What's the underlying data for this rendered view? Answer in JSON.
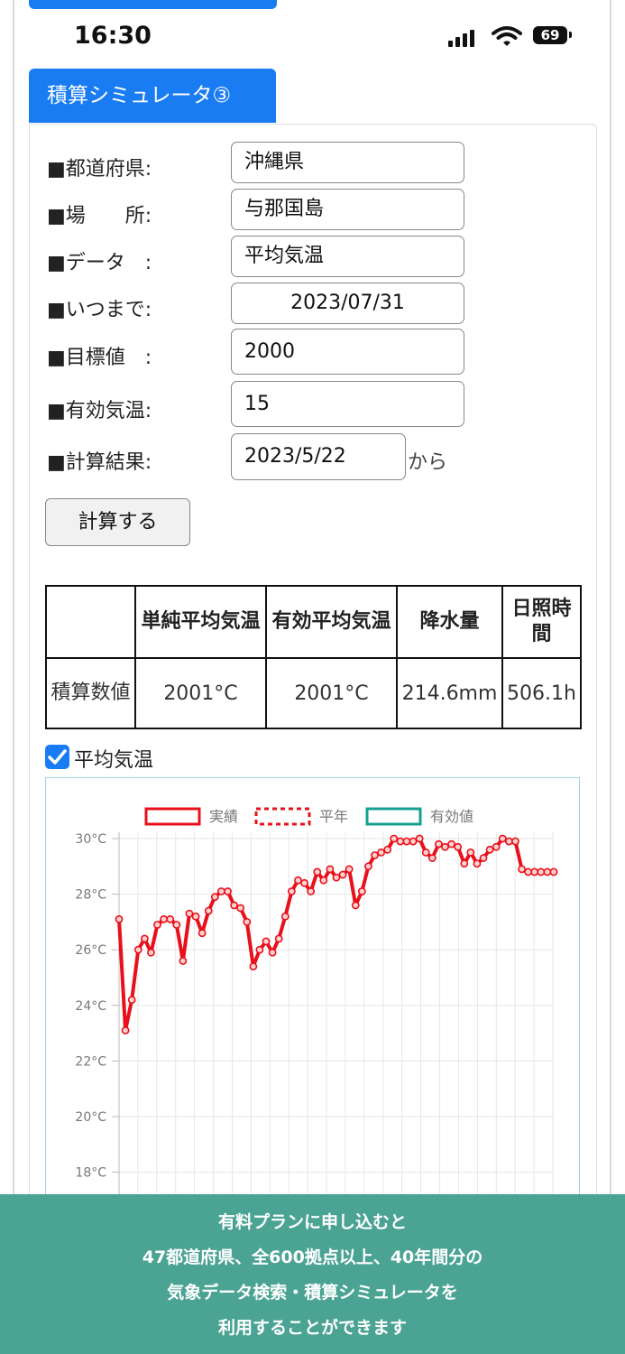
{
  "status_bar": {
    "time": "16:30",
    "battery": "69"
  },
  "tab": {
    "title": "積算シミュレータ③"
  },
  "form": {
    "prefecture": {
      "label": "■都道府県:",
      "value": "沖縄県"
    },
    "location": {
      "label": "■場　　所:",
      "value": "与那国島"
    },
    "data": {
      "label": "■データ　:",
      "value": "平均気温"
    },
    "until": {
      "label": "■いつまで:",
      "value": "2023/07/31"
    },
    "target": {
      "label": "■目標値　:",
      "value": "2000"
    },
    "effective_temp": {
      "label": "■有効気温:",
      "value": "15"
    },
    "result": {
      "label": "■計算結果:",
      "value": "2023/5/22",
      "suffix": "から"
    },
    "button": "計算する"
  },
  "summary_table": {
    "headers": [
      "",
      "単純平均気温",
      "有効平均気温",
      "降水量",
      "日照時間"
    ],
    "row_label": "積算数値",
    "values": [
      "2001°C",
      "2001°C",
      "214.6mm",
      "506.1h"
    ]
  },
  "checkbox": {
    "label": "平均気温",
    "checked": true
  },
  "chart_data": {
    "type": "line",
    "legend": [
      "実績",
      "平年",
      "有効値"
    ],
    "legend_position": "top",
    "y_ticks": [
      "30°C",
      "28°C",
      "26°C",
      "24°C",
      "22°C",
      "20°C",
      "18°C"
    ],
    "ylim": [
      17,
      30.5
    ],
    "grid": true,
    "colors": {
      "actual": "#e8101a",
      "effective": "#16a091"
    },
    "series": [
      {
        "name": "実績",
        "values": [
          27.1,
          23.1,
          24.2,
          26.0,
          26.4,
          25.9,
          26.9,
          27.1,
          27.1,
          26.9,
          25.6,
          27.3,
          27.2,
          26.6,
          27.4,
          27.9,
          28.1,
          28.1,
          27.6,
          27.5,
          27.0,
          25.4,
          26.0,
          26.3,
          25.9,
          26.4,
          27.2,
          28.1,
          28.5,
          28.4,
          28.1,
          28.8,
          28.5,
          28.9,
          28.6,
          28.7,
          28.9,
          27.6,
          28.1,
          29.0,
          29.4,
          29.5,
          29.6,
          30.0,
          29.9,
          29.9,
          29.9,
          30.0,
          29.5,
          29.3,
          29.8,
          29.7,
          29.8,
          29.7,
          29.1,
          29.5,
          29.1,
          29.3,
          29.6,
          29.7,
          30.0,
          29.9,
          29.9,
          28.9,
          28.8,
          28.8,
          28.8,
          28.8,
          28.8
        ]
      }
    ]
  },
  "banner": {
    "lines": [
      "有料プランに申し込むと",
      "47都道府県、全600拠点以上、40年間分の",
      "気象データ検索・積算シミュレータを",
      "利用することができます"
    ]
  }
}
